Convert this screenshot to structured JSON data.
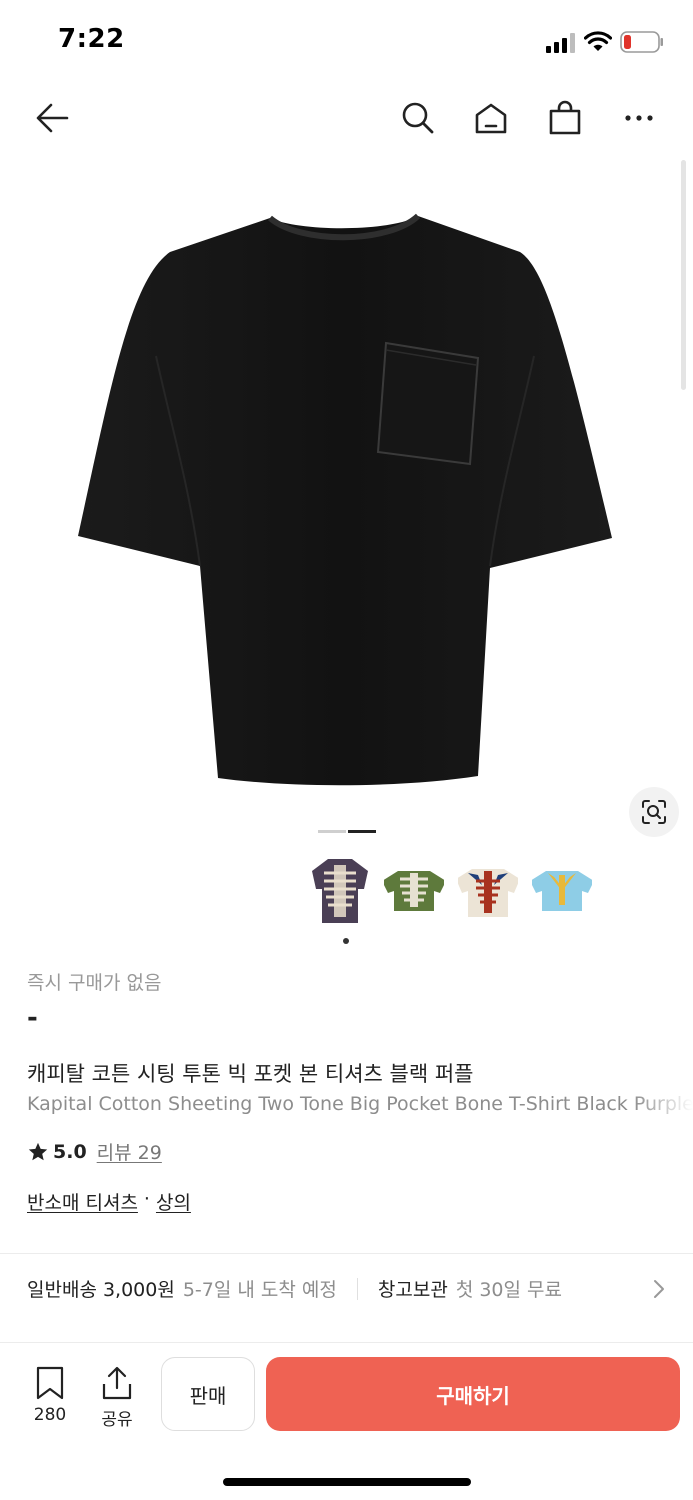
{
  "status_bar": {
    "time": "7:22",
    "battery_color": "#e0342b"
  },
  "nav": {
    "icons": [
      "back-arrow-icon",
      "search-icon",
      "home-icon",
      "shopping-bag-icon",
      "more-icon"
    ]
  },
  "gallery": {
    "pages": 2,
    "active_page": 2,
    "thumbnails": [
      {
        "name": "purple-bone-tshirt",
        "color": "#4a3f55",
        "selected": true
      },
      {
        "name": "green-bone-tshirt",
        "color": "#5e7a3c",
        "selected": false
      },
      {
        "name": "cream-bone-tshirt",
        "color": "#ece4d6",
        "selected": false
      },
      {
        "name": "blue-bone-tshirt",
        "color": "#8ecde6",
        "selected": false
      }
    ],
    "product_color": "#141414"
  },
  "product": {
    "instant_buy_status": "즉시 구매가 없음",
    "price": "-",
    "title_ko": "캐피탈 코튼 시팅 투톤 빅 포켓 본 티셔츠 블랙 퍼플",
    "title_en": "Kapital Cotton Sheeting Two Tone Big Pocket Bone T-Shirt Black Purple",
    "rating": "5.0",
    "review_label": "리뷰 29",
    "category_1": "반소매 티셔츠",
    "category_sep": "·",
    "category_2": "상의"
  },
  "shipping": {
    "standard_label": "일반배송 3,000원",
    "standard_eta": "5-7일 내 도착 예정",
    "storage_label": "창고보관",
    "storage_promo": "첫 30일 무료"
  },
  "bottom_bar": {
    "bookmark_count": "280",
    "share_label": "공유",
    "sell_label": "판매",
    "buy_label": "구매하기",
    "buy_color": "#ef6253"
  }
}
